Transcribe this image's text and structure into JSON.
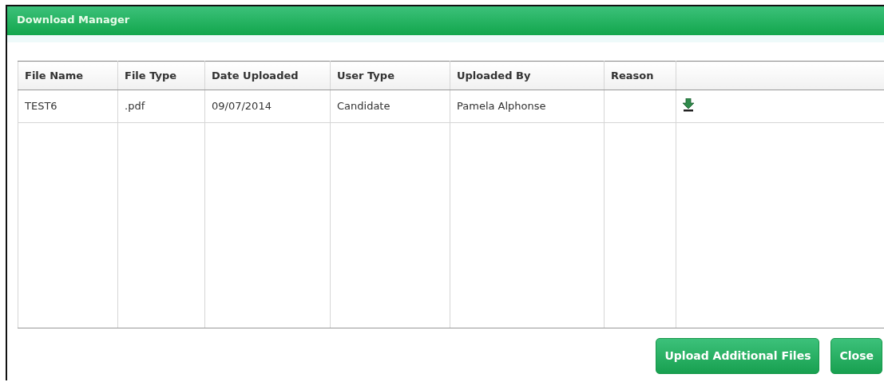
{
  "window": {
    "title": "Download Manager"
  },
  "table": {
    "columns": [
      "File Name",
      "File Type",
      "Date Uploaded",
      "User Type",
      "Uploaded By",
      "Reason"
    ],
    "rows": [
      {
        "cells": [
          "TEST6",
          ".pdf",
          "09/07/2014",
          "Candidate",
          "Pamela Alphonse",
          ""
        ],
        "download": true
      }
    ]
  },
  "buttons": [
    {
      "label": "Upload Additional Files"
    },
    {
      "label": "Close"
    }
  ]
}
